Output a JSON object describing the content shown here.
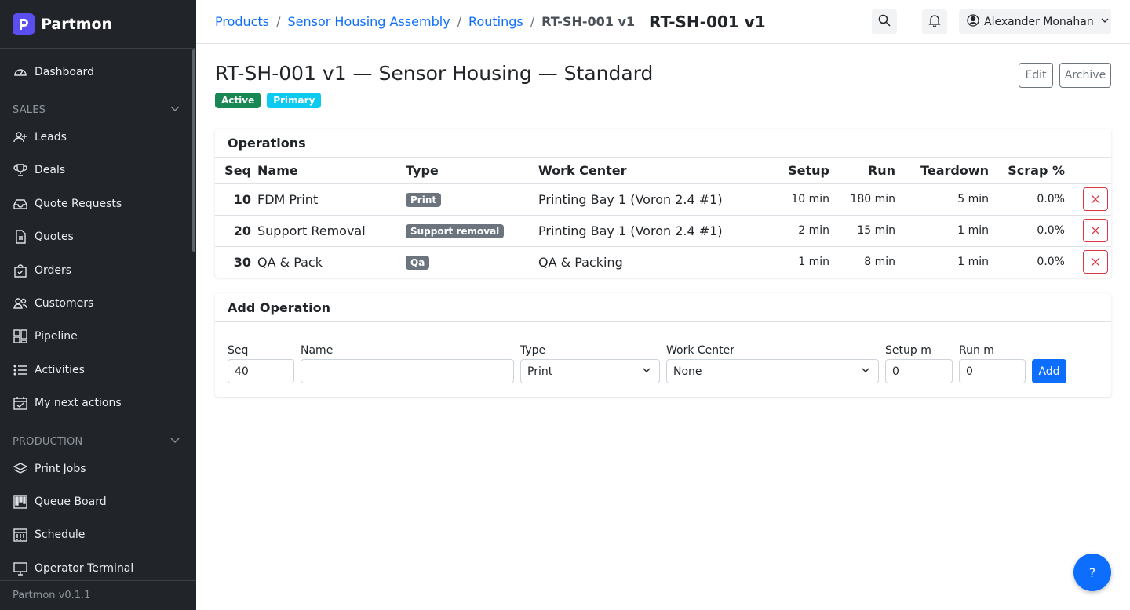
{
  "app": {
    "name": "Partmon",
    "version": "Partmon v0.1.1"
  },
  "sidebar": {
    "dashboard": "Dashboard",
    "sales_section": "SALES",
    "sales_items": [
      "Leads",
      "Deals",
      "Quote Requests",
      "Quotes",
      "Orders",
      "Customers",
      "Pipeline",
      "Activities",
      "My next actions"
    ],
    "production_section": "PRODUCTION",
    "production_items": [
      "Print Jobs",
      "Queue Board",
      "Schedule",
      "Operator Terminal"
    ]
  },
  "header": {
    "breadcrumbs": [
      "Products",
      "Sensor Housing Assembly",
      "Routings"
    ],
    "breadcrumb_current": "RT-SH-001 v1",
    "title": "RT-SH-001 v1",
    "user_name": "Alexander Monahan"
  },
  "page": {
    "title": "RT-SH-001 v1 — Sensor Housing — Standard",
    "status_badge": "Active",
    "primary_badge": "Primary",
    "edit_label": "Edit",
    "archive_label": "Archive"
  },
  "operations": {
    "title": "Operations",
    "columns": [
      "Seq",
      "Name",
      "Type",
      "Work Center",
      "Setup",
      "Run",
      "Teardown",
      "Scrap %"
    ],
    "rows": [
      {
        "seq": "10",
        "name": "FDM Print",
        "type": "Print",
        "work_center": "Printing Bay 1 (Voron 2.4 #1)",
        "setup": "10 min",
        "run": "180 min",
        "teardown": "5 min",
        "scrap": "0.0%"
      },
      {
        "seq": "20",
        "name": "Support Removal",
        "type": "Support removal",
        "work_center": "Printing Bay 1 (Voron 2.4 #1)",
        "setup": "2 min",
        "run": "15 min",
        "teardown": "1 min",
        "scrap": "0.0%"
      },
      {
        "seq": "30",
        "name": "QA & Pack",
        "type": "Qa",
        "work_center": "QA & Packing",
        "setup": "1 min",
        "run": "8 min",
        "teardown": "1 min",
        "scrap": "0.0%"
      }
    ]
  },
  "add_operation": {
    "title": "Add Operation",
    "labels": {
      "seq": "Seq",
      "name": "Name",
      "type": "Type",
      "work_center": "Work Center",
      "setup": "Setup m",
      "run": "Run m"
    },
    "values": {
      "seq": "40",
      "name": "",
      "type": "Print",
      "work_center": "None",
      "setup": "0",
      "run": "0"
    },
    "add_label": "Add"
  },
  "help_label": "?",
  "colors": {
    "sidebar_bg": "#212529",
    "accent": "#0d6efd",
    "active": "#198754",
    "primary_badge": "#0dcaf0",
    "danger": "#dc3545",
    "brand": "#5b4ef0"
  }
}
